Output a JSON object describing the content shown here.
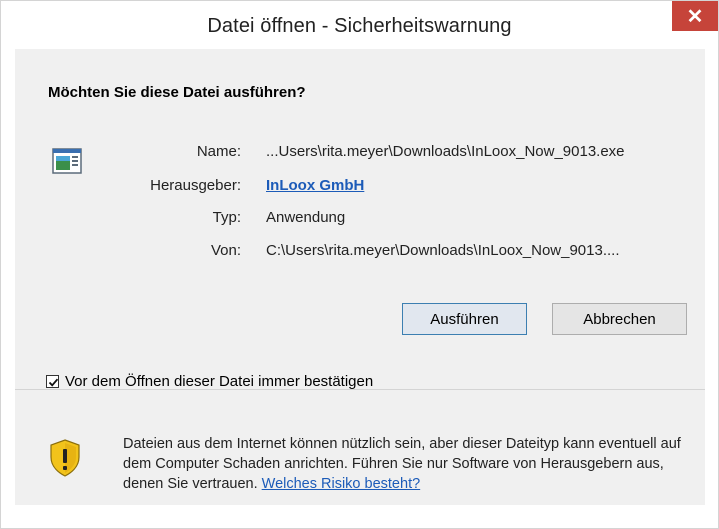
{
  "window": {
    "title": "Datei öffnen - Sicherheitswarnung",
    "close_glyph": "✕"
  },
  "prompt": {
    "question": "Möchten Sie diese Datei ausführen?"
  },
  "file_info": {
    "icon": "executable-file-icon",
    "rows": [
      {
        "label": "Name:",
        "value": "...Users\\rita.meyer\\Downloads\\InLoox_Now_9013.exe"
      },
      {
        "label": "Herausgeber:",
        "value": "InLoox GmbH"
      },
      {
        "label": "Typ:",
        "value": "Anwendung"
      },
      {
        "label": "Von:",
        "value": "C:\\Users\\rita.meyer\\Downloads\\InLoox_Now_9013...."
      }
    ]
  },
  "buttons": {
    "run_label": "Ausführen",
    "cancel_label": "Abbrechen"
  },
  "checkbox": {
    "label": "Vor dem Öffnen dieser Datei immer bestätigen",
    "checked": true
  },
  "warning": {
    "icon": "security-shield-warning-icon",
    "text": "Dateien aus dem Internet können nützlich sein, aber dieser Dateityp kann eventuell auf dem Computer Schaden anrichten. Führen Sie nur Software von Herausgebern aus, denen Sie vertrauen.",
    "link_text": "Welches Risiko besteht?"
  },
  "colors": {
    "close_button": "#c6443a",
    "link": "#1c5bb8",
    "panel_bg": "#f0f0f0",
    "shield_yellow": "#f2c31b"
  }
}
